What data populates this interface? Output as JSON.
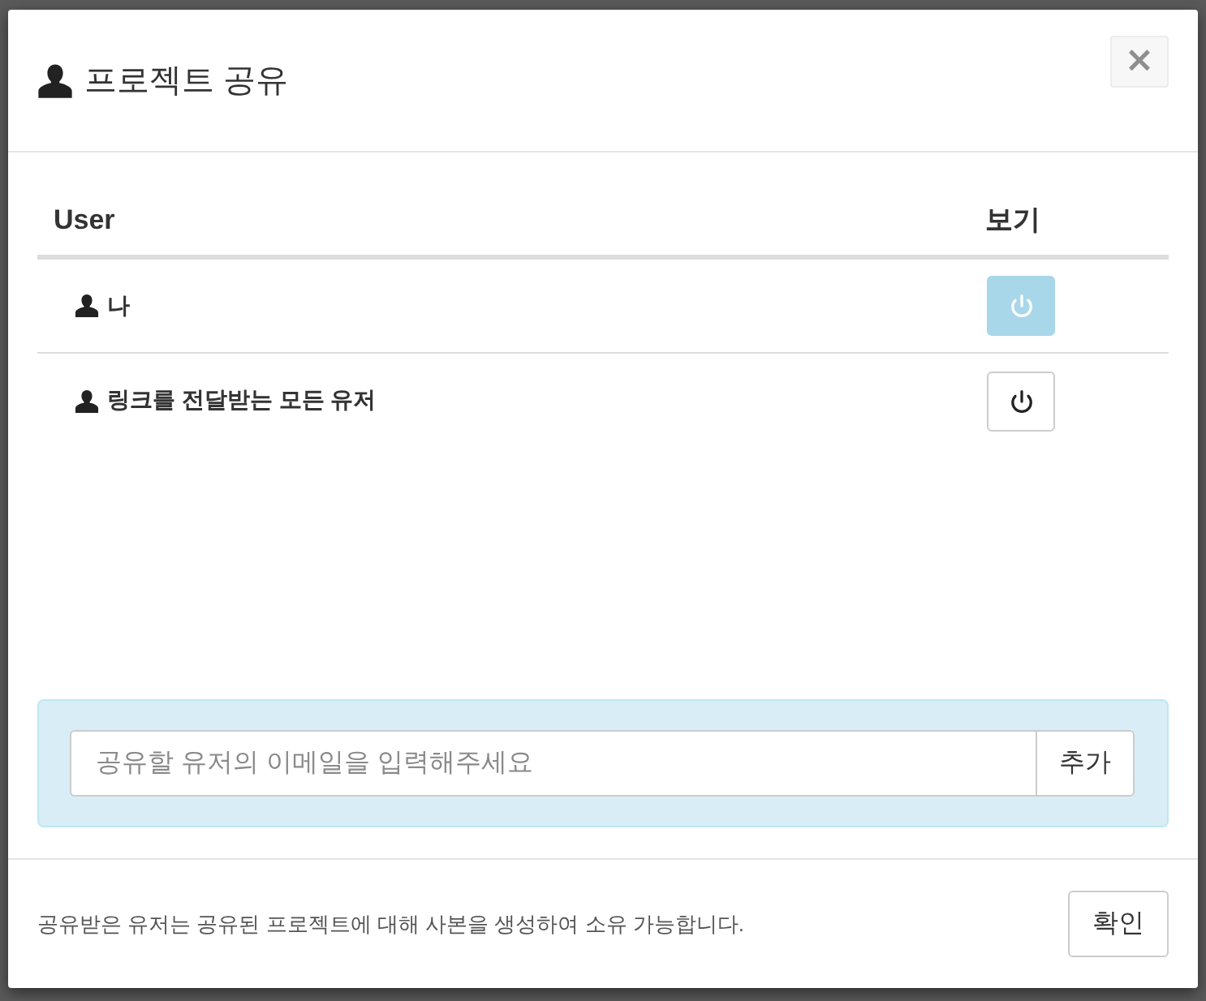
{
  "dialog": {
    "title": "프로젝트 공유",
    "close_label": "×"
  },
  "table": {
    "columns": [
      "User",
      "보기"
    ],
    "rows": [
      {
        "user": "나",
        "on": true
      },
      {
        "user": "링크를 전달받는 모든 유저",
        "on": false
      }
    ]
  },
  "invite": {
    "placeholder": "공유할 유저의 이메일을 입력해주세요",
    "button": "추가"
  },
  "footer": {
    "note": "공유받은 유저는 공유된 프로젝트에 대해 사본을 생성하여 소유 가능합니다.",
    "button": "확인"
  }
}
